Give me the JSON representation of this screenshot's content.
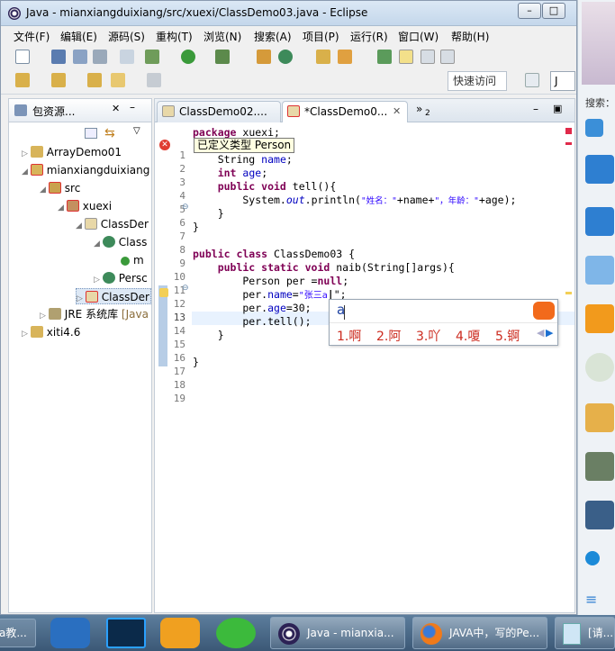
{
  "window": {
    "title": "Java  -  mianxiangduixiang/src/xuexi/ClassDemo03.java  -  Eclipse",
    "min": "–",
    "max": "□",
    "close": "✕"
  },
  "menu": [
    "文件(F)",
    "编辑(E)",
    "源码(S)",
    "重构(T)",
    "浏览(N)",
    "搜索(A)",
    "项目(P)",
    "运行(R)",
    "窗口(W)",
    "帮助(H)"
  ],
  "toolbar": {
    "quick_access": "快速访问",
    "perspective": "J"
  },
  "package_explorer": {
    "tab_label": "包资源...",
    "tree": [
      {
        "label": "ArrayDemo01"
      },
      {
        "label": "mianxiangduixiang"
      },
      {
        "label": "src"
      },
      {
        "label": "xuexi"
      },
      {
        "label": "ClassDer"
      },
      {
        "label": "Class"
      },
      {
        "label": "m"
      },
      {
        "label": "Persc"
      },
      {
        "label": "ClassDer"
      },
      {
        "label": "JRE 系统库",
        "suffix": "[Java"
      },
      {
        "label": "xiti4.6"
      }
    ]
  },
  "editor": {
    "tabs": [
      {
        "label": "ClassDemo02...."
      },
      {
        "label": "*ClassDemo0..."
      }
    ],
    "overflow_count": "2",
    "lines": [
      "1",
      "2",
      "3",
      "4",
      "5",
      "6",
      "7",
      "8",
      "9",
      "10",
      "11",
      "12",
      "13",
      "14",
      "15",
      "16",
      "17",
      "18",
      "19"
    ],
    "tooltip": "已定义类型 Person",
    "code": {
      "l1_kw": "package",
      "l1_rest": " xuexi;",
      "l3_a": "    String ",
      "l3_f": "name",
      "l3_b": ";",
      "l4_kw": "    int",
      "l4_sp": " ",
      "l4_f": "age",
      "l4_b": ";",
      "l5_kw": "    public void",
      "l5_rest": " tell(){",
      "l6_a": "        System.",
      "l6_out": "out",
      "l6_b": ".println(",
      "l6_s1": "\"姓名：\"",
      "l6_c": "+name+",
      "l6_s2": "\"，年龄：\"",
      "l6_d": "+age);",
      "l7": "    }",
      "l8": "}",
      "l10_kw": "public class",
      "l10_rest": " ClassDemo03 {",
      "l11_kw": "    public static void",
      "l11_rest": " naib(String[]args){",
      "l12_a": "        Person per =",
      "l12_kw": "null",
      "l12_b": ";",
      "l13_a": "        per.",
      "l13_f": "name",
      "l13_b": "=",
      "l13_s": "\"张三a",
      "l13_cur": "|",
      "l13_c": "\";",
      "l14_a": "        per.",
      "l14_f": "age",
      "l14_b": "=30;",
      "l15": "        per.tell();",
      "l16": "    }",
      "l18": "}"
    }
  },
  "ime": {
    "input": "a",
    "candidates": [
      "1.啊",
      "2.阿",
      "3.吖",
      "4.嗄",
      "5.锕"
    ]
  },
  "right_sidebar": {
    "search_label": "搜索："
  },
  "taskbar": {
    "left_label": "a教...",
    "windows": [
      {
        "label": "Java  -  mianxia..."
      },
      {
        "label": "JAVA中，写的Pe..."
      },
      {
        "label": "[请..."
      }
    ]
  },
  "colors": {
    "keyword": "#7f0055",
    "field": "#0000c0",
    "string": "#2a00ff",
    "error": "#e03c31",
    "ime_candidate": "#cc2a1e"
  }
}
